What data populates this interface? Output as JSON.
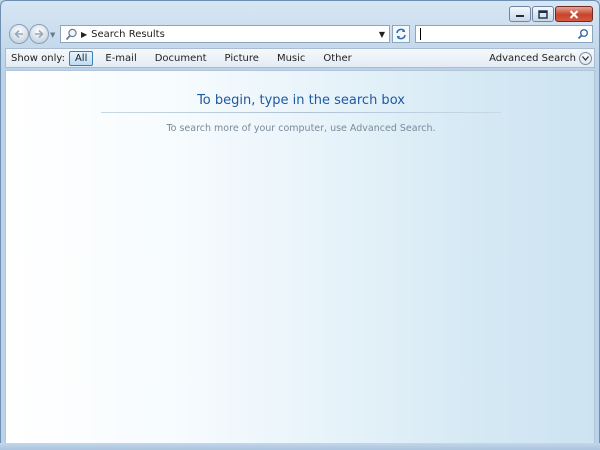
{
  "window": {
    "caption_buttons": {
      "minimize": "minimize-icon",
      "maximize": "maximize-icon",
      "close": "close-icon"
    }
  },
  "navigation": {
    "back_icon": "back-arrow-icon",
    "forward_icon": "forward-arrow-icon"
  },
  "address_bar": {
    "path": "Search Results",
    "icon": "search-folder-icon"
  },
  "search": {
    "value": "",
    "placeholder": "",
    "icon": "search-icon"
  },
  "toolbar": {
    "show_only_label": "Show only:",
    "filters": [
      "All",
      "E-mail",
      "Document",
      "Picture",
      "Music",
      "Other"
    ],
    "selected_filter": "All",
    "advanced_search_label": "Advanced Search"
  },
  "content": {
    "title": "To begin, type in the search box",
    "hint": "To search more of your computer, use Advanced Search."
  },
  "colors": {
    "accent": "#1e5aa0",
    "hint_text": "#7a8a99",
    "close_button": "#c6442d"
  }
}
